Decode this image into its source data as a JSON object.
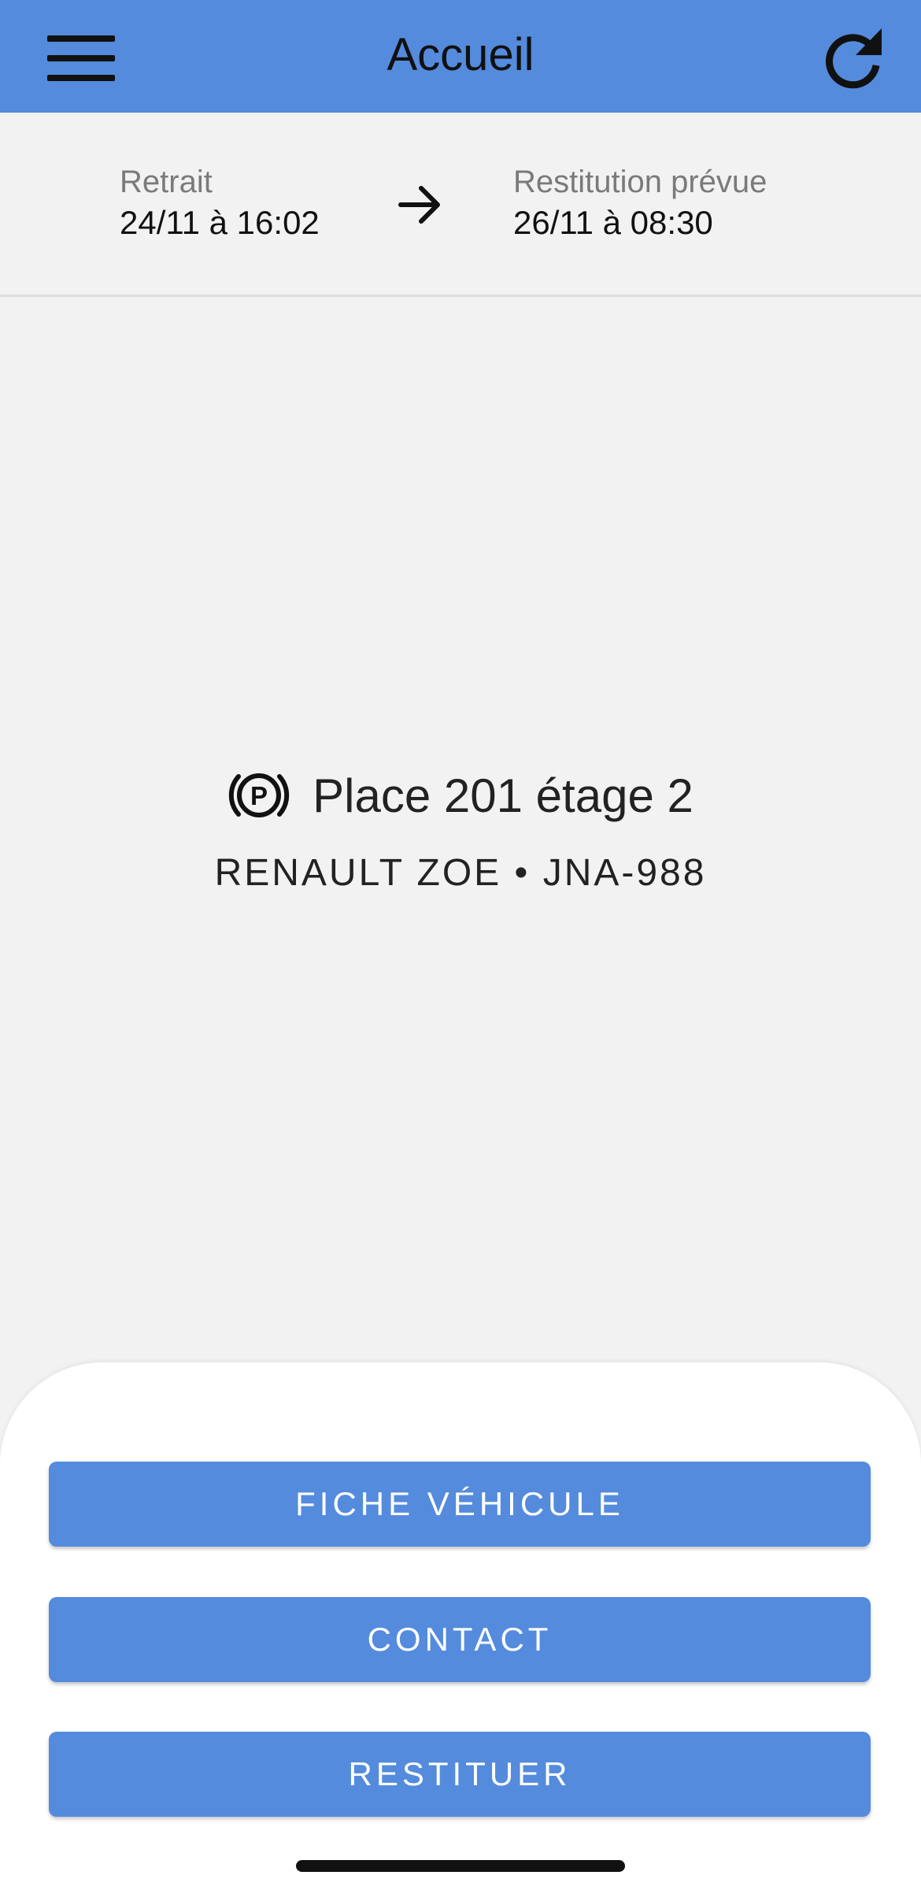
{
  "header": {
    "title": "Accueil",
    "menu_icon": "hamburger-menu-icon",
    "refresh_icon": "refresh-icon",
    "background_color": "#548bdd"
  },
  "trip": {
    "pickup_label": "Retrait",
    "pickup_value": "24/11 à 16:02",
    "return_label": "Restitution prévue",
    "return_value": "26/11 à 08:30",
    "arrow_icon": "arrow-right-icon"
  },
  "vehicle": {
    "parking_icon": "parking-icon",
    "place": "Place 201 étage 2",
    "model": "RENAULT ZOE",
    "separator": "•",
    "plate": "JNA-988"
  },
  "actions": {
    "vehicle_sheet": "FICHE VÉHICULE",
    "contact": "CONTACT",
    "return": "RESTITUER"
  },
  "colors": {
    "accent": "#548bdd",
    "background": "#f2f2f2",
    "sheet": "#ffffff"
  }
}
